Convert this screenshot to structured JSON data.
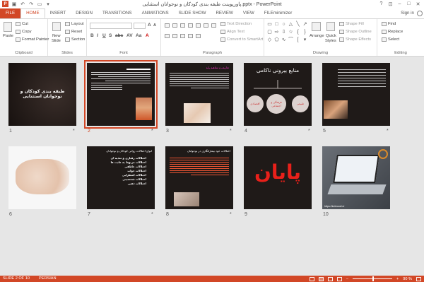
{
  "window": {
    "title": "پاورپوینت طبقه بندی کودکان و نوجوانان استثنایی.pptx - PowerPoint",
    "qat_logo": "P"
  },
  "tabs": {
    "file": "FILE",
    "items": [
      "HOME",
      "INSERT",
      "DESIGN",
      "TRANSITIONS",
      "ANIMATIONS",
      "SLIDE SHOW",
      "REVIEW",
      "VIEW",
      "FILEminimizer"
    ],
    "active": "HOME",
    "signin": "Sign in"
  },
  "ribbon": {
    "clipboard": {
      "label": "Clipboard",
      "paste": "Paste",
      "cut": "Cut",
      "copy": "Copy",
      "format_painter": "Format Painter"
    },
    "slides": {
      "label": "Slides",
      "new_slide": "New",
      "new_slide2": "Slide",
      "layout": "Layout",
      "reset": "Reset",
      "section": "Section"
    },
    "font": {
      "label": "Font"
    },
    "paragraph": {
      "label": "Paragraph",
      "text_direction": "Text Direction",
      "align_text": "Align Text",
      "convert_smartart": "Convert to SmartArt"
    },
    "drawing": {
      "label": "Drawing",
      "arrange": "Arrange",
      "quick_styles": "Quick",
      "quick_styles2": "Styles",
      "shape_fill": "Shape Fill",
      "shape_outline": "Shape Outline",
      "shape_effects": "Shape Effects"
    },
    "editing": {
      "label": "Editing",
      "find": "Find",
      "replace": "Replace",
      "select": "Select"
    }
  },
  "slides": [
    {
      "num": "1",
      "star": "*",
      "title": "طبقه بندی کودکان و نوجوانان استثنایی"
    },
    {
      "num": "2",
      "star": "*",
      "selected": true
    },
    {
      "num": "3",
      "star": "*",
      "heading": "تعاریف و مفاهیم پایه",
      "lines": [
        "هاوش باتک - دکتر ر ترجمه",
        "یکدوک نامز زا امش زا یخرب"
      ]
    },
    {
      "num": "4",
      "star": "*",
      "title": "منابع بیرونی ناکامی",
      "circle_left": "اقتصادی",
      "circle_mid": "فرهنگی و اجتماعی",
      "circle_right": "طبیعی"
    },
    {
      "num": "5",
      "star": "*"
    },
    {
      "num": "6",
      "star": ""
    },
    {
      "num": "7",
      "star": "*",
      "heading": "انواع اختلالات روانی کودکان و نوجوانان",
      "items": [
        "اختلالات رفتاری و تغذیه ای",
        "اختلالات مربوط به عادت ها",
        "اختلالات عاطفی",
        "اختلالات خواب",
        "اختلالات اضطرابی",
        "اختلالات شخصیتی",
        "اختلالات ذهنی"
      ]
    },
    {
      "num": "8",
      "star": "*",
      "heading": "اختلالات خود بیمارانگاری در نوجوانان"
    },
    {
      "num": "9",
      "star": "",
      "title": "پایان"
    },
    {
      "num": "10",
      "star": "",
      "site": "https://kebroosh.ir"
    }
  ],
  "statusbar": {
    "slide": "SLIDE 2 OF 10",
    "language": "PERSIAN",
    "zoom": "90 %",
    "zoom_level": 0.5
  }
}
